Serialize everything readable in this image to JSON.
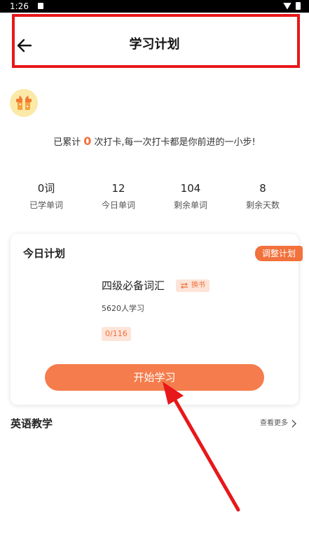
{
  "status_bar": {
    "time": "1:26"
  },
  "header": {
    "title": "学习计划"
  },
  "checkin": {
    "prefix": "已累计",
    "count": "0",
    "suffix": "次打卡,每一次打卡都是你前进的一小步!"
  },
  "stats": [
    {
      "value": "0词",
      "label": "已学单词"
    },
    {
      "value": "12",
      "label": "今日单词"
    },
    {
      "value": "104",
      "label": "剩余单词"
    },
    {
      "value": "8",
      "label": "剩余天数"
    }
  ],
  "plan": {
    "title": "今日计划",
    "adjust_label": "调整计划",
    "book_name": "四级必备词汇",
    "swap_label": "换书",
    "learners": "5620人学习",
    "progress": "0/116",
    "start_label": "开始学习"
  },
  "section": {
    "title": "英语教学",
    "more_label": "查看更多"
  },
  "colors": {
    "accent": "#f57c4c",
    "accent_light": "#fde4d8",
    "annotation_red": "#e8171a"
  }
}
